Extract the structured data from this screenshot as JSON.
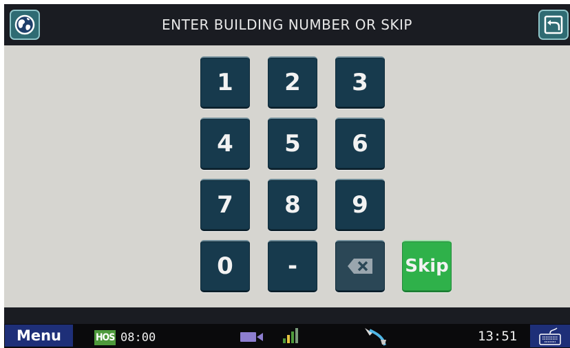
{
  "header": {
    "title": "ENTER BUILDING NUMBER OR SKIP",
    "left_icon": "globe-icon",
    "right_icon": "back-icon"
  },
  "keypad": {
    "keys": [
      "1",
      "2",
      "3",
      "4",
      "5",
      "6",
      "7",
      "8",
      "9",
      "0",
      "-"
    ],
    "backspace_icon": "backspace-icon",
    "skip_label": "Skip"
  },
  "statusbar": {
    "menu_label": "Menu",
    "hos_badge": "HOS",
    "hos_time": "08:00",
    "camera_icon": "camera-icon",
    "signal_icon": "signal-icon",
    "network_icon": "network-cable-icon",
    "clock": "13:51",
    "keyboard_icon": "keyboard-icon"
  },
  "colors": {
    "header_bg": "#1a1c22",
    "key_bg": "#173a4d",
    "skip_bg": "#2fb14a",
    "content_bg": "#d6d5d0",
    "menu_bg": "#1e2f78",
    "hos_bg": "#4e9a3c"
  }
}
